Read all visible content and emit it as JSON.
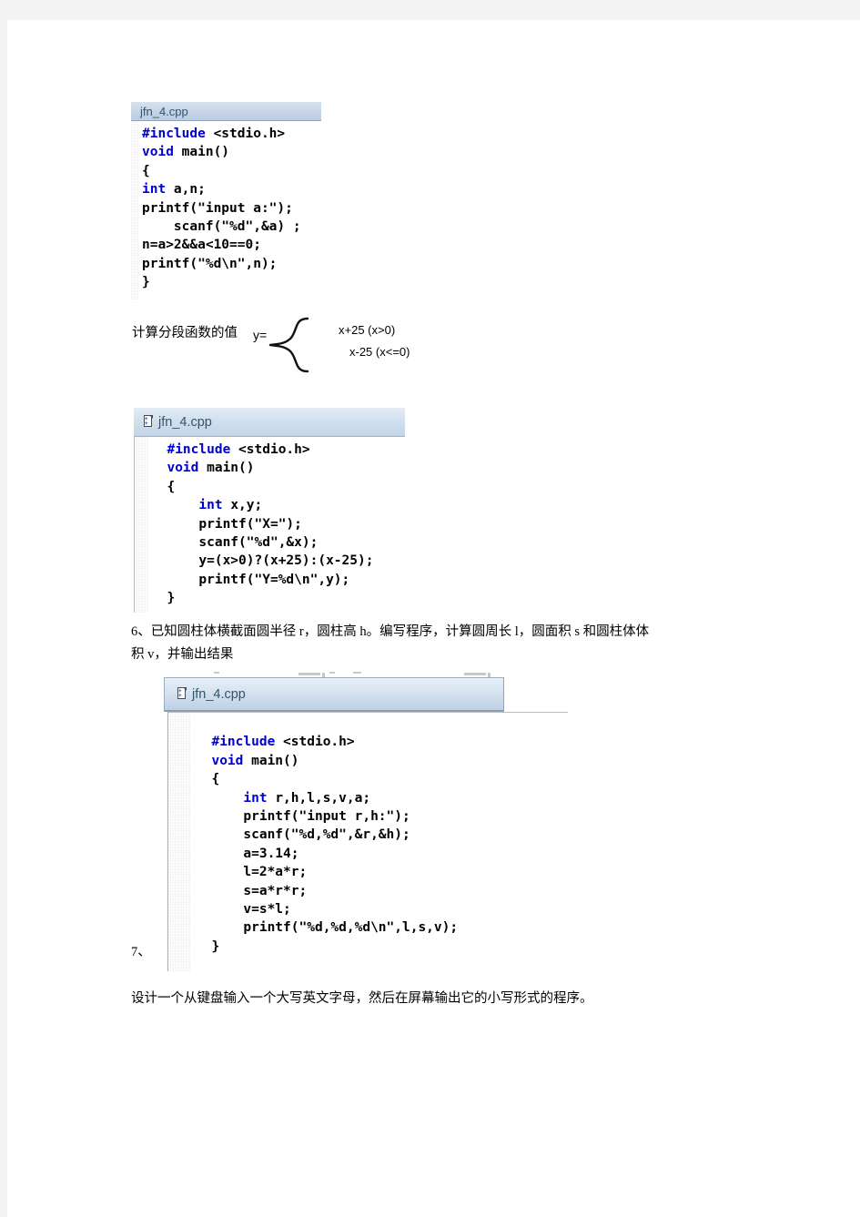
{
  "document": {
    "page_background": "#ffffff",
    "canvas_background": "#f4f4f4"
  },
  "code_windows": [
    {
      "id": "window-1",
      "title": "jfn_4.cpp",
      "has_icon": false,
      "titlebar_color": "#cdd9e6",
      "keyword_color": "#0000d0",
      "lines": [
        "#include <stdio.h>",
        "void main()",
        "{",
        "int a,n;",
        "printf(\"input a:\");",
        "    scanf(\"%d\",&a) ;",
        "n=a>2&&a<10==0;",
        "printf(\"%d\\n\",n);",
        "}"
      ]
    },
    {
      "id": "window-2",
      "title": "jfn_4.cpp",
      "has_icon": true,
      "titlebar_color": "#ccd9e8",
      "keyword_color": "#0000d0",
      "lines": [
        "  #include <stdio.h>",
        "  void main()",
        "  {",
        "      int x,y;",
        "      printf(\"X=\");",
        "      scanf(\"%d\",&x);",
        "      y=(x>0)?(x+25):(x-25);",
        "      printf(\"Y=%d\\n\",y);",
        "  }"
      ]
    },
    {
      "id": "window-3",
      "title": "jfn_4.cpp",
      "has_icon": true,
      "titlebar_color": "#c6d7e9",
      "keyword_color": "#0000d0",
      "lines": [
        "",
        "  #include <stdio.h>",
        "  void main()",
        "  {",
        "      int r,h,l,s,v,a;",
        "      printf(\"input r,h:\");",
        "      scanf(\"%d,%d\",&r,&h);",
        "      a=3.14;",
        "      l=2*a*r;",
        "      s=a*r*r;",
        "      v=s*l;",
        "      printf(\"%d,%d,%d\\n\",l,s,v);",
        "  }"
      ]
    }
  ],
  "piecewise": {
    "label": "计算分段函数的值",
    "variable": "y=",
    "case_top": "x+25 (x>0)",
    "case_bottom": "x-25 (x<=0)"
  },
  "paragraphs": {
    "q6_line1": "6、已知圆柱体横截面圆半径 r，圆柱高 h。编写程序，计算圆周长 l，圆面积 s 和圆柱体体",
    "q6_line2": "积 v，并输出结果",
    "q7_marker": "7、",
    "q7_text": "设计一个从键盘输入一个大写英文字母，然后在屏幕输出它的小写形式的程序。"
  }
}
